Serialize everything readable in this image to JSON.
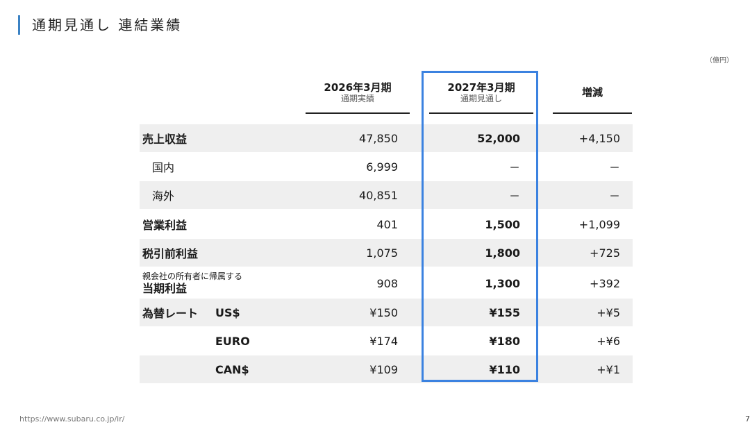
{
  "page": {
    "title": "通期見通し 連結業績",
    "unit": "（億円）",
    "footer_url": "https://www.subaru.co.jp/ir/",
    "page_number": "7"
  },
  "columns": [
    {
      "main": "2026年3月期",
      "sub": "通期実績"
    },
    {
      "main": "2027年3月期",
      "sub": "通期見通し"
    },
    {
      "main": "増減",
      "sub": ""
    }
  ],
  "rows": [
    {
      "label": "売上収益",
      "fy2026": "47,850",
      "fy2027": "52,000",
      "change": "+4,150"
    },
    {
      "label": "国内",
      "fy2026": "6,999",
      "fy2027": "－",
      "change": "－"
    },
    {
      "label": "海外",
      "fy2026": "40,851",
      "fy2027": "－",
      "change": "－"
    },
    {
      "label": "営業利益",
      "fy2026": "401",
      "fy2027": "1,500",
      "change": "+1,099"
    },
    {
      "label": "税引前利益",
      "fy2026": "1,075",
      "fy2027": "1,800",
      "change": "+725"
    },
    {
      "label_small": "親会社の所有者に帰属する",
      "label": "当期利益",
      "fy2026": "908",
      "fy2027": "1,300",
      "change": "+392"
    },
    {
      "label": "為替レート",
      "sublabel": "US$",
      "fy2026": "¥150",
      "fy2027": "¥155",
      "change": "+¥5"
    },
    {
      "sublabel": "EURO",
      "fy2026": "¥174",
      "fy2027": "¥180",
      "change": "+¥6"
    },
    {
      "sublabel": "CAN$",
      "fy2026": "¥109",
      "fy2027": "¥110",
      "change": "+¥1"
    }
  ],
  "colors": {
    "accent": "#3b82c4",
    "highlight_border": "#3b82e0",
    "row_shade": "#efefef"
  }
}
